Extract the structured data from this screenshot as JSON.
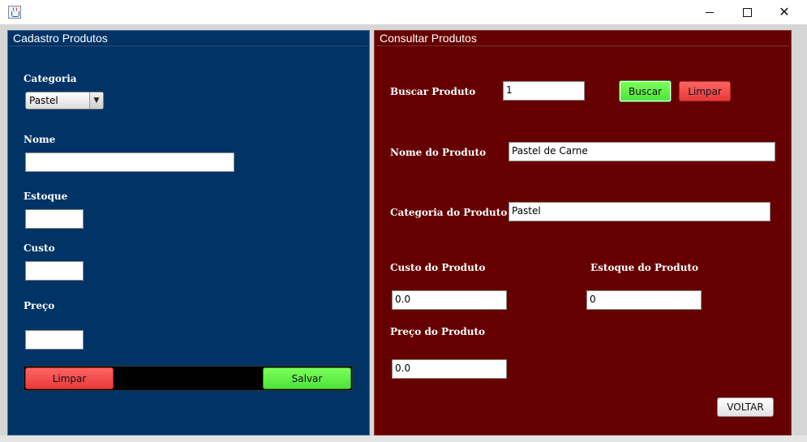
{
  "window": {
    "title": ""
  },
  "cadastro": {
    "title": "Cadastro Produtos",
    "categoria_label": "Categoria",
    "categoria_value": "Pastel",
    "nome_label": "Nome",
    "nome_value": "",
    "estoque_label": "Estoque",
    "estoque_value": "",
    "custo_label": "Custo",
    "custo_value": "",
    "preco_label": "Preço",
    "preco_value": "",
    "limpar_label": "Limpar",
    "salvar_label": "Salvar"
  },
  "consulta": {
    "title": "Consultar Produtos",
    "buscar_label": "Buscar Produto",
    "buscar_value": "1",
    "buscar_button": "Buscar",
    "limpar_button": "Limpar",
    "nome_label": "Nome do Produto",
    "nome_value": "Pastel de Carne",
    "categoria_label": "Categoria do Produto",
    "categoria_value": "Pastel",
    "custo_label": "Custo do Produto",
    "custo_value": "0.0",
    "estoque_label": "Estoque do Produto",
    "estoque_value": "0",
    "preco_label": "Preço do Produto",
    "preco_value": "0.0",
    "voltar_button": "VOLTAR"
  },
  "colors": {
    "cadastro_bg": "#003366",
    "consulta_bg": "#660000",
    "button_red": "#f04848",
    "button_green": "#66f04c"
  },
  "icons": {
    "app": "java-coffee-cup-icon",
    "minimize": "minimize-icon",
    "maximize": "maximize-icon",
    "close": "close-icon",
    "combo_arrow": "chevron-down-icon"
  }
}
